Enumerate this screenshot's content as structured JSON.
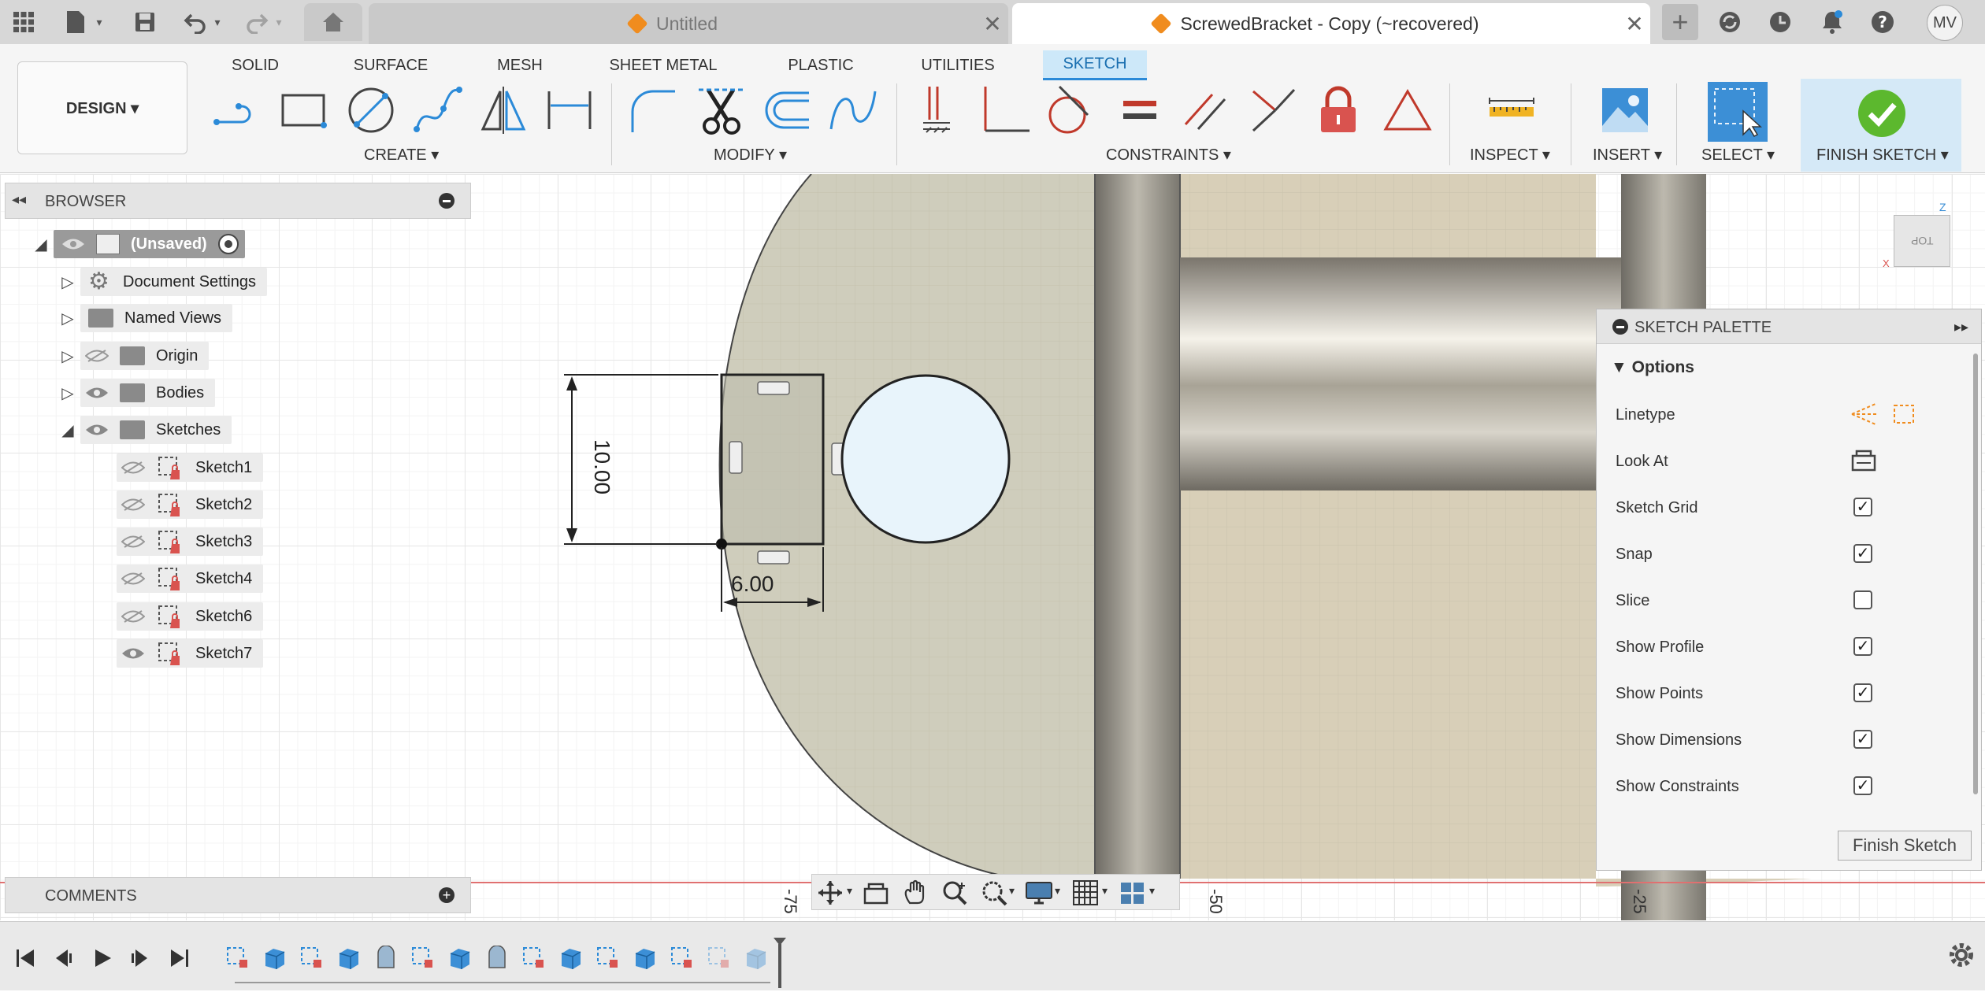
{
  "topbar": {
    "tabs": [
      {
        "label": "Untitled",
        "close": "✕"
      },
      {
        "label": "ScrewedBracket - Copy (~recovered)",
        "close": "✕"
      }
    ],
    "new_tab": "+",
    "avatar": "MV"
  },
  "toolbar": {
    "workspace": "DESIGN ▾",
    "tabs": [
      "SOLID",
      "SURFACE",
      "MESH",
      "SHEET METAL",
      "PLASTIC",
      "UTILITIES",
      "SKETCH"
    ],
    "groups": {
      "create": "CREATE ▾",
      "modify": "MODIFY ▾",
      "constraints": "CONSTRAINTS ▾",
      "inspect": "INSPECT ▾",
      "insert": "INSERT ▾",
      "select": "SELECT ▾",
      "finish": "FINISH SKETCH ▾"
    }
  },
  "browser": {
    "title": "BROWSER",
    "root": "(Unsaved)",
    "items": [
      "Document Settings",
      "Named Views",
      "Origin",
      "Bodies",
      "Sketches"
    ],
    "sketches": [
      "Sketch1",
      "Sketch2",
      "Sketch3",
      "Sketch4",
      "Sketch6",
      "Sketch7"
    ]
  },
  "comments": {
    "title": "COMMENTS"
  },
  "palette": {
    "title": "SKETCH PALETTE",
    "section": "Options",
    "linetype": "Linetype",
    "lookat": "Look At",
    "options": [
      {
        "label": "Sketch Grid",
        "checked": true
      },
      {
        "label": "Snap",
        "checked": true
      },
      {
        "label": "Slice",
        "checked": false
      },
      {
        "label": "Show Profile",
        "checked": true
      },
      {
        "label": "Show Points",
        "checked": true
      },
      {
        "label": "Show Dimensions",
        "checked": true
      },
      {
        "label": "Show Constraints",
        "checked": true
      }
    ],
    "finish_button": "Finish Sketch"
  },
  "canvas": {
    "dim_height": "10.00",
    "dim_width": "6.00",
    "ruler": [
      "-75",
      "-50",
      "-25"
    ],
    "viewcube": "TOP",
    "axis_z": "Z",
    "axis_x": "X"
  }
}
